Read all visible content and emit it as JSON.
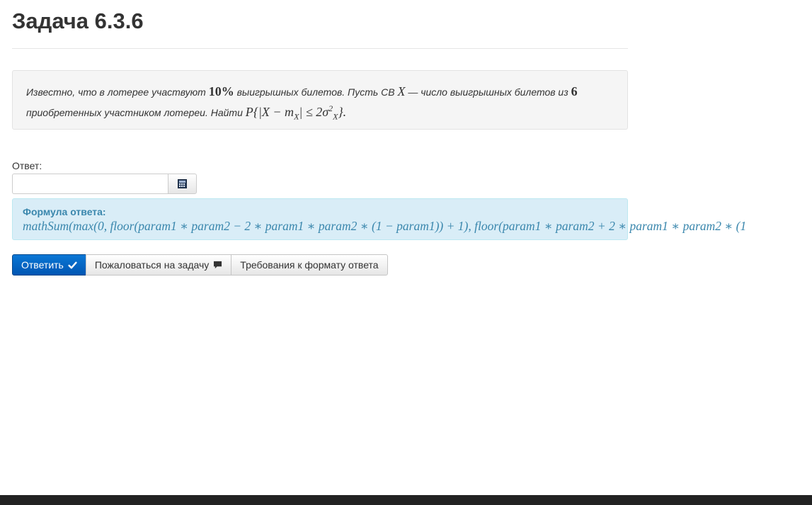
{
  "page": {
    "title": "Задача 6.3.6"
  },
  "problem": {
    "text1": "Известно, что в лотерее участвуют ",
    "math_percent": "10%",
    "text2": " выигрышных билетов. Пусть СВ ",
    "math_x": "X",
    "text3": " — число выигрышных билетов из ",
    "math_n": "6",
    "text4": "приобретенных участником лотереи. Найти ",
    "math_p": "P",
    "math_expr_open": "{|X − m",
    "math_sub_x": "X",
    "math_expr_mid": "| ≤ 2σ",
    "math_sup_2": "2",
    "math_sub_x2": "X",
    "math_expr_close": "}."
  },
  "answer": {
    "label": "Ответ:",
    "input_value": "",
    "input_placeholder": "",
    "calculator_icon": "calculator-icon"
  },
  "formula": {
    "heading": "Формула ответа:",
    "text": "mathSum(max(0, floor(param1 ∗ param2 − 2 ∗ param1 ∗ param2 ∗ (1 − param1)) + 1), floor(param1 ∗ param2 + 2 ∗ param1 ∗ param2 ∗ (1"
  },
  "buttons": {
    "submit_label": "Ответить",
    "submit_icon": "check-icon",
    "complain_label": "Пожаловаться на задачу",
    "complain_icon": "comment-icon",
    "requirements_label": "Требования к формату ответа"
  },
  "colors": {
    "primary": "#0a77d5",
    "info_bg": "#d9edf7",
    "info_text": "#3a87ad",
    "well_bg": "#f5f5f5",
    "bottom_bar": "#222222"
  }
}
